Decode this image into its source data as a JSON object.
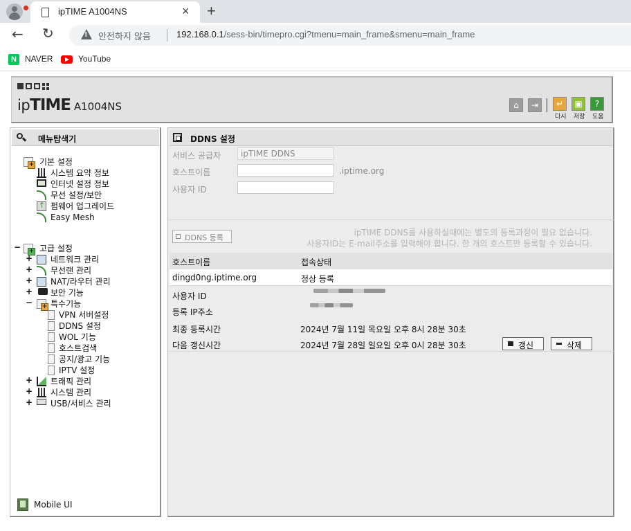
{
  "browser": {
    "tab_title": "ipTIME A1004NS",
    "new_tab_glyph": "+",
    "close_glyph": "×",
    "security_label": "안전하지 않음",
    "url_host": "192.168.0.1",
    "url_path": "/sess-bin/timepro.cgi?tmenu=main_frame&smenu=main_frame",
    "bookmarks": [
      {
        "label": "NAVER",
        "icon": "naver-icon"
      },
      {
        "label": "YouTube",
        "icon": "youtube-icon"
      }
    ],
    "naver_letter": "N"
  },
  "header": {
    "brand_ip": "ip",
    "brand_time": "TIME",
    "model": "A1004NS",
    "buttons": {
      "reload": "다시",
      "save": "저장",
      "help": "도움"
    }
  },
  "sidebar": {
    "title": "메뉴탐색기",
    "basic": {
      "label": "기본 설정",
      "items": [
        "시스템 요약 정보",
        "인터넷 설정 정보",
        "무선 설정/보안",
        "펌웨어 업그레이드",
        "Easy Mesh"
      ]
    },
    "advanced": {
      "label": "고급 설정",
      "items": [
        "네트워크 관리",
        "무선랜 관리",
        "NAT/라우터 관리",
        "보안 기능",
        "특수기능"
      ],
      "special_children": [
        "VPN 서버설정",
        "DDNS 설정",
        "WOL 기능",
        "호스트검색",
        "공지/광고 기능",
        "IPTV 설정"
      ],
      "more_items": [
        "트래픽 관리",
        "시스템 관리",
        "USB/서비스 관리"
      ]
    },
    "mobile_ui": "Mobile UI"
  },
  "main": {
    "title": "DDNS 설정",
    "form": {
      "provider_label": "서비스 공급자",
      "provider_value": "ipTIME DDNS",
      "hostname_label": "호스트이름",
      "hostname_value": "",
      "hostname_suffix": ".iptime.org",
      "userid_label": "사용자 ID",
      "userid_value": ""
    },
    "register_button": "DDNS 등록",
    "notes": [
      "ipTIME DDNS를 사용하실때에는 별도의 등록과정이 필요 없습니다.",
      "사용자ID는 E-mail주소를 입력해야 합니다. 한 개의 호스트만 등록할 수 있습니다."
    ],
    "table": {
      "headers": [
        "호스트이름",
        "접속상태"
      ],
      "row": [
        "dingd0ng.iptime.org",
        "정상 등록"
      ]
    },
    "details": [
      {
        "label": "사용자 ID",
        "value": ""
      },
      {
        "label": "등록 IP주소",
        "value": ""
      },
      {
        "label": "최종 등록시간",
        "value": "2024년 7월 11일 목요일 오후 8시 28분 30초"
      },
      {
        "label": "다음 갱신시간",
        "value": "2024년 7월 28일 일요일 오후 0시 28분 30초"
      }
    ],
    "refresh_button": "갱신",
    "delete_button": "삭제"
  }
}
